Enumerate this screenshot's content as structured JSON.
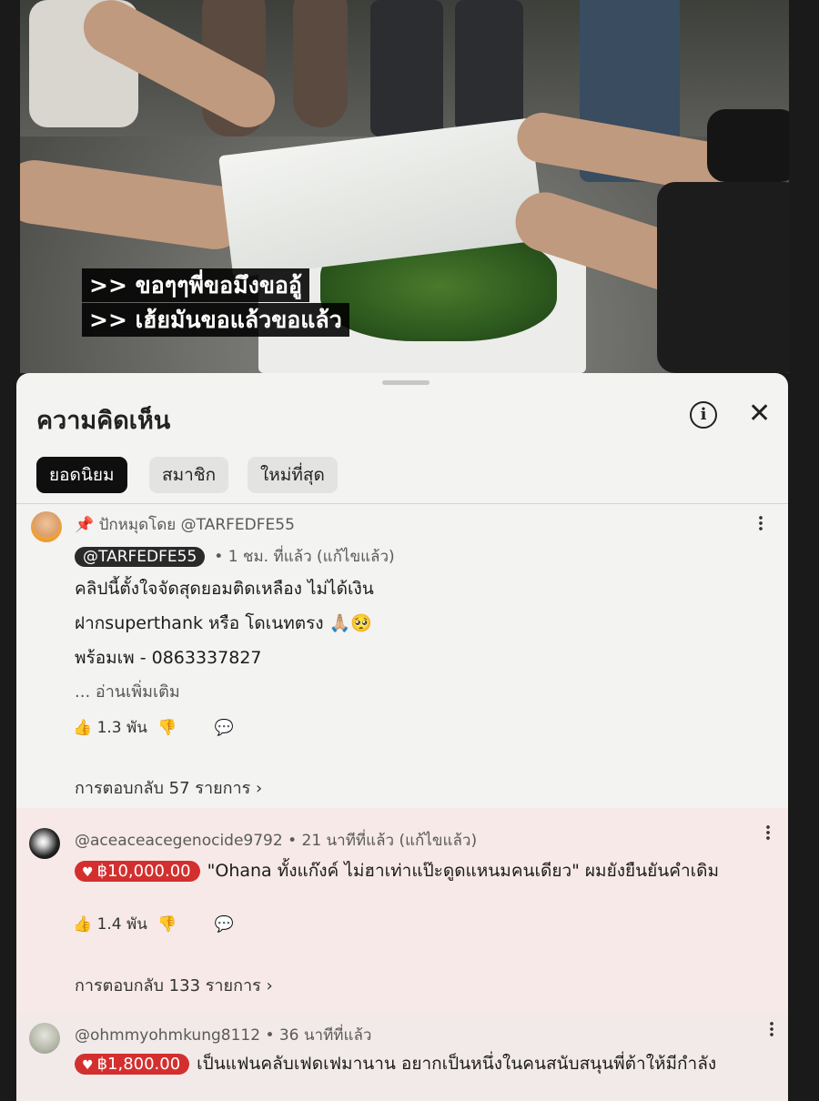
{
  "video": {
    "subtitle_line1": ">> ขอๆๆพี่ขอมึงขออู้",
    "subtitle_line2": ">> เฮ้ยมันขอแล้วขอแล้ว"
  },
  "comments_panel": {
    "title": "ความคิดเห็น",
    "filters": [
      {
        "label": "ยอดนิยม",
        "selected": true
      },
      {
        "label": "สมาชิก",
        "selected": false
      },
      {
        "label": "ใหม่ที่สุด",
        "selected": false
      }
    ]
  },
  "comments": [
    {
      "pinned_label": "ปักหมุดโดย @TARFEDFE55",
      "author": "@TARFEDFE55",
      "time": "• 1 ชม. ที่แล้ว (แก้ไขแล้ว)",
      "lines": [
        "คลิปนี้ตั้งใจจัดสุดยอมติดเหลือง ไม่ได้เงิน",
        "ฝากsuperthank หรือ โดเนทตรง 🙏🏼🥺",
        "พร้อมเพ - 0863337827"
      ],
      "read_more": "... อ่านเพิ่มเติม",
      "likes": "1.3 พัน",
      "replies": "การตอบกลับ 57 รายการ"
    },
    {
      "author": "@aceaceacegenocide9792",
      "time": "• 21 นาทีที่แล้ว (แก้ไขแล้ว)",
      "thanks_amount": "฿10,000.00",
      "lines": [
        "\"Ohana ทั้งแก๊งค์ ไม่ฮาเท่าแป๊ะดูดแหนมคนเดียว\" ผมยังยืนยันคำเดิม"
      ],
      "likes": "1.4 พัน",
      "replies": "การตอบกลับ 133 รายการ"
    },
    {
      "author": "@ohmmyohmkung8112",
      "time": "• 36 นาทีที่แล้ว",
      "thanks_amount": "฿1,800.00",
      "lines": [
        "เป็นแฟนคลับเฟดเฟมานาน อยากเป็นหนึ่งในคนสนับสนุนพี่ต้าให้มีกำลัง"
      ]
    }
  ],
  "colors": {
    "thanks_badge": "#d32f2f",
    "active_chip": "#0f0f0f",
    "highlight_bg": "#f6e9e7"
  }
}
